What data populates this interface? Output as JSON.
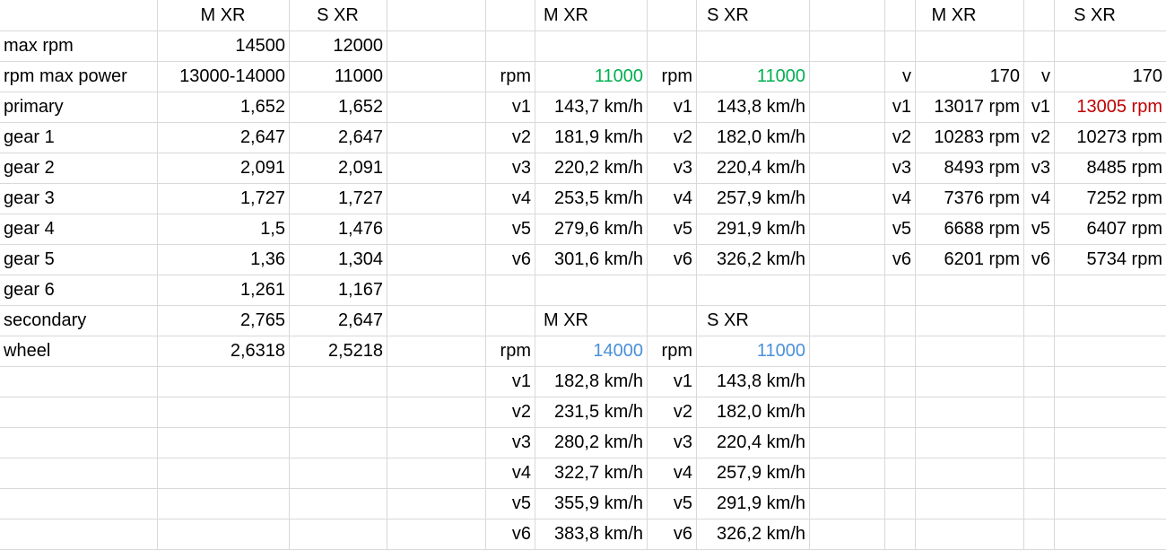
{
  "colors": {
    "green": "#00b050",
    "blue": "#4a90d9",
    "red": "#c00000",
    "gridline": "#d9d9d9"
  },
  "specs": {
    "headers": [
      "M XR",
      "S XR"
    ],
    "rows": [
      {
        "label": "max rpm",
        "m": "14500",
        "s": "12000"
      },
      {
        "label": "rpm max power",
        "m": "13000-14000",
        "s": "11000"
      },
      {
        "label": "primary",
        "m": "1,652",
        "s": "1,652"
      },
      {
        "label": "gear 1",
        "m": "2,647",
        "s": "2,647"
      },
      {
        "label": "gear 2",
        "m": "2,091",
        "s": "2,091"
      },
      {
        "label": "gear 3",
        "m": "1,727",
        "s": "1,727"
      },
      {
        "label": "gear 4",
        "m": "1,5",
        "s": "1,476"
      },
      {
        "label": "gear 5",
        "m": "1,36",
        "s": "1,304"
      },
      {
        "label": "gear 6",
        "m": "1,261",
        "s": "1,167"
      },
      {
        "label": "secondary",
        "m": "2,765",
        "s": "2,647"
      },
      {
        "label": "wheel",
        "m": "2,6318",
        "s": "2,5218"
      }
    ]
  },
  "speed_top": {
    "m_title": "M XR",
    "s_title": "S XR",
    "m_rpm_label": "rpm",
    "m_rpm": "11000",
    "s_rpm_label": "rpm",
    "s_rpm": "11000",
    "rows": [
      {
        "g": "v1",
        "m": "143,7 km/h",
        "s": "143,8 km/h"
      },
      {
        "g": "v2",
        "m": "181,9 km/h",
        "s": "182,0 km/h"
      },
      {
        "g": "v3",
        "m": "220,2 km/h",
        "s": "220,4 km/h"
      },
      {
        "g": "v4",
        "m": "253,5 km/h",
        "s": "257,9 km/h"
      },
      {
        "g": "v5",
        "m": "279,6 km/h",
        "s": "291,9 km/h"
      },
      {
        "g": "v6",
        "m": "301,6 km/h",
        "s": "326,2 km/h"
      }
    ]
  },
  "speed_bottom": {
    "m_title": "M XR",
    "s_title": "S XR",
    "m_rpm_label": "rpm",
    "m_rpm": "14000",
    "s_rpm_label": "rpm",
    "s_rpm": "11000",
    "rows": [
      {
        "g": "v1",
        "m": "182,8 km/h",
        "s": "143,8 km/h"
      },
      {
        "g": "v2",
        "m": "231,5 km/h",
        "s": "182,0 km/h"
      },
      {
        "g": "v3",
        "m": "280,2 km/h",
        "s": "220,4 km/h"
      },
      {
        "g": "v4",
        "m": "322,7 km/h",
        "s": "257,9 km/h"
      },
      {
        "g": "v5",
        "m": "355,9 km/h",
        "s": "291,9 km/h"
      },
      {
        "g": "v6",
        "m": "383,8 km/h",
        "s": "326,2 km/h"
      }
    ]
  },
  "rpm_table": {
    "m_title": "M XR",
    "s_title": "S XR",
    "m_v_label": "v",
    "m_v": "170",
    "s_v_label": "v",
    "s_v": "170",
    "rows": [
      {
        "g": "v1",
        "m": "13017 rpm",
        "s": "13005 rpm"
      },
      {
        "g": "v2",
        "m": "10283 rpm",
        "s": "10273 rpm"
      },
      {
        "g": "v3",
        "m": "8493 rpm",
        "s": "8485 rpm"
      },
      {
        "g": "v4",
        "m": "7376 rpm",
        "s": "7252 rpm"
      },
      {
        "g": "v5",
        "m": "6688 rpm",
        "s": "6407 rpm"
      },
      {
        "g": "v6",
        "m": "6201 rpm",
        "s": "5734 rpm"
      }
    ]
  }
}
